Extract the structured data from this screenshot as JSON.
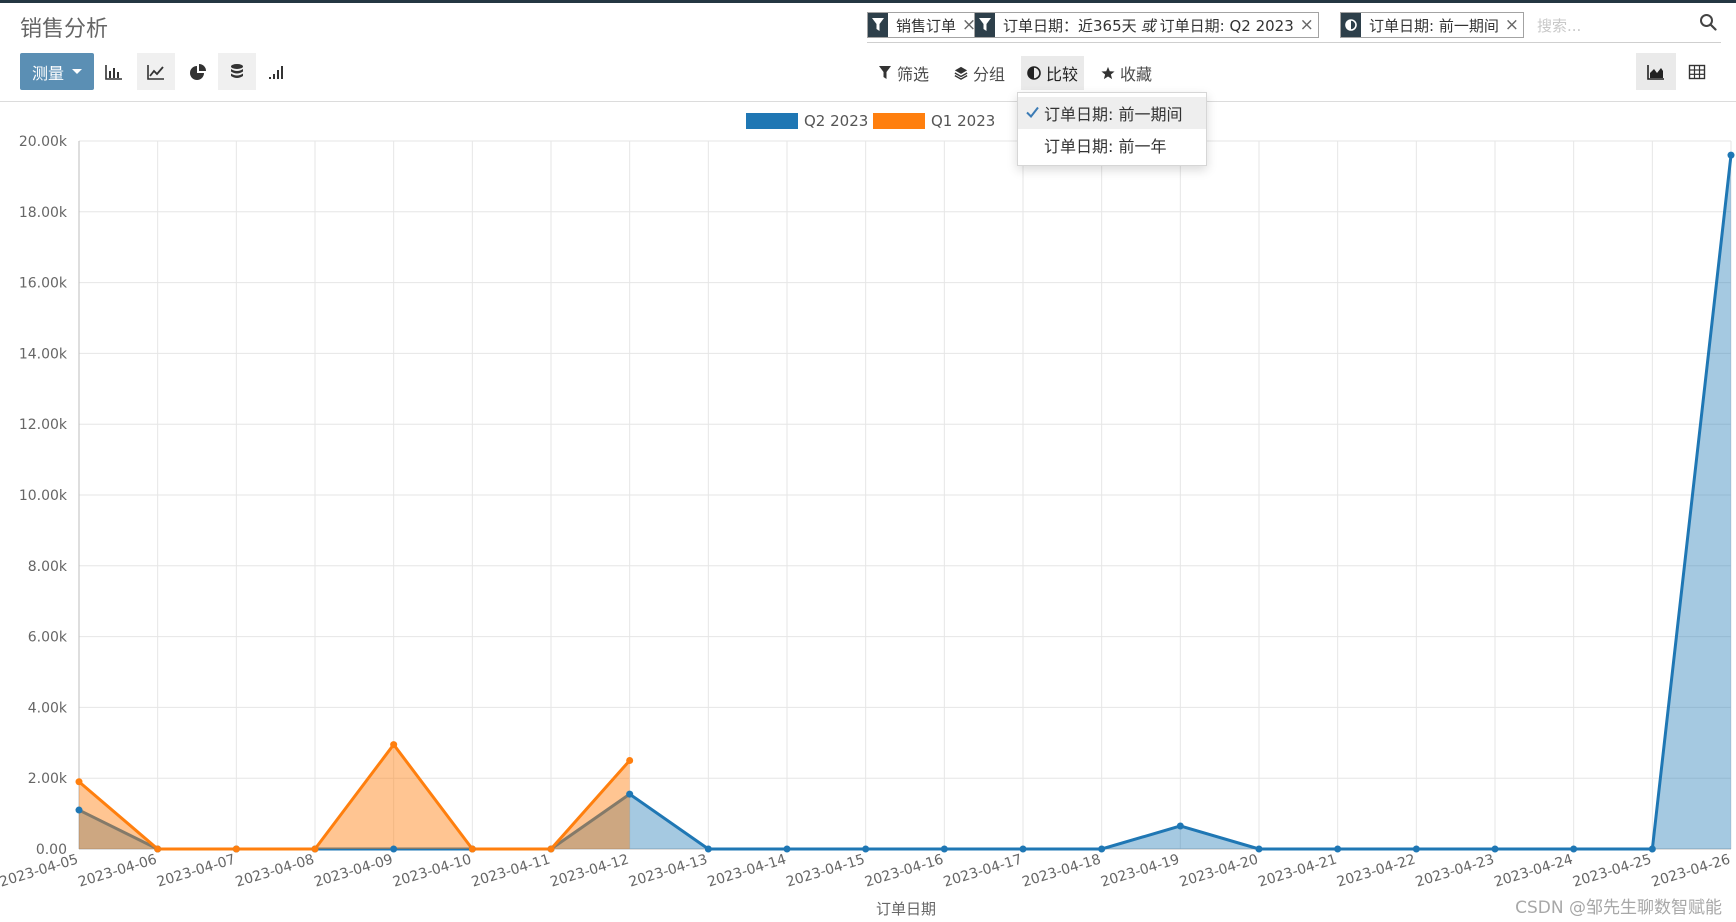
{
  "app": {
    "title": "销售分析"
  },
  "search": {
    "facets": [
      {
        "icon": "filter-icon",
        "text": "销售订单"
      },
      {
        "icon": "filter-icon",
        "text_a": "订单日期：近365天",
        "or": "或",
        "text_b": "订单日期: Q2 2023"
      },
      {
        "icon": "compare-icon",
        "text": "订单日期: 前一期间"
      }
    ],
    "placeholder": "搜索..."
  },
  "toolbar": {
    "measure_label": "测量",
    "filter_label": "筛选",
    "group_label": "分组",
    "compare_label": "比较",
    "favorites_label": "收藏"
  },
  "compare_menu": {
    "items": [
      {
        "label": "订单日期: 前一期间",
        "checked": true
      },
      {
        "label": "订单日期: 前一年",
        "checked": false
      }
    ]
  },
  "colors": {
    "q2": "#1f77b4",
    "q1": "#ff7f0e"
  },
  "chart_data": {
    "type": "area",
    "x": [
      "2023-04-05",
      "2023-04-06",
      "2023-04-07",
      "2023-04-08",
      "2023-04-09",
      "2023-04-10",
      "2023-04-11",
      "2023-04-12",
      "2023-04-13",
      "2023-04-14",
      "2023-04-15",
      "2023-04-16",
      "2023-04-17",
      "2023-04-18",
      "2023-04-19",
      "2023-04-20",
      "2023-04-21",
      "2023-04-22",
      "2023-04-23",
      "2023-04-24",
      "2023-04-25",
      "2023-04-26"
    ],
    "series": [
      {
        "name": "Q2 2023",
        "color": "#1f77b4",
        "values": [
          1100,
          0,
          0,
          0,
          0,
          0,
          0,
          1550,
          0,
          0,
          0,
          0,
          0,
          0,
          650,
          0,
          0,
          0,
          0,
          0,
          0,
          19600
        ]
      },
      {
        "name": "Q1 2023",
        "color": "#ff7f0e",
        "values": [
          1900,
          0,
          0,
          0,
          2950,
          0,
          0,
          2500,
          null,
          null,
          null,
          null,
          null,
          null,
          null,
          null,
          null,
          null,
          null,
          null,
          null,
          null
        ]
      }
    ],
    "y_ticks": [
      "0.00",
      "2.00k",
      "4.00k",
      "6.00k",
      "8.00k",
      "10.00k",
      "12.00k",
      "14.00k",
      "16.00k",
      "18.00k",
      "20.00k"
    ],
    "ylim": [
      0,
      20000
    ],
    "xlabel": "订单日期",
    "ylabel": "",
    "legend_position": "top-center",
    "grid": true
  },
  "watermark": "CSDN @邹先生聊数智赋能"
}
